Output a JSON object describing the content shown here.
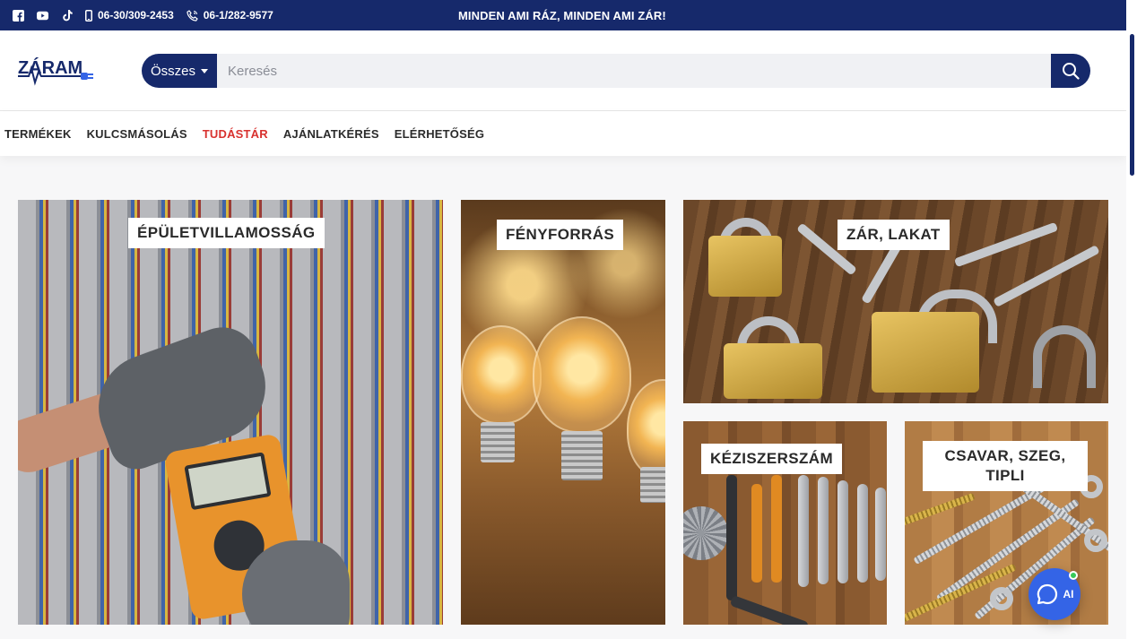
{
  "topbar": {
    "phone_mobile": "06-30/309-2453",
    "phone_landline": "06-1/282-9577",
    "slogan": "MINDEN AMI RÁZ, MINDEN AMI ZÁR!",
    "social": [
      "facebook-icon",
      "youtube-icon",
      "tiktok-icon"
    ]
  },
  "header": {
    "logo_text": "ZÁRAM",
    "search": {
      "category_label": "Összes",
      "placeholder": "Keresés",
      "value": ""
    }
  },
  "nav": {
    "items": [
      {
        "label": "TERMÉKEK",
        "active": false
      },
      {
        "label": "KULCSMÁSOLÁS",
        "active": false
      },
      {
        "label": "TUDÁSTÁR",
        "active": true
      },
      {
        "label": "AJÁNLATKÉRÉS",
        "active": false
      },
      {
        "label": "ELÉRHETŐSÉG",
        "active": false
      }
    ]
  },
  "categories": [
    {
      "label": "ÉPÜLETVILLAMOSSÁG"
    },
    {
      "label": "FÉNYFORRÁS"
    },
    {
      "label": "ZÁR, LAKAT"
    },
    {
      "label": "KÉZISZERSZÁM"
    },
    {
      "label": "CSAVAR, SZEG, TIPLI"
    }
  ],
  "chat": {
    "label": "AI"
  },
  "colors": {
    "brand_navy": "#16296b",
    "active_red": "#d8322f",
    "chat_blue": "#3464e6",
    "online_green": "#37c95a"
  }
}
